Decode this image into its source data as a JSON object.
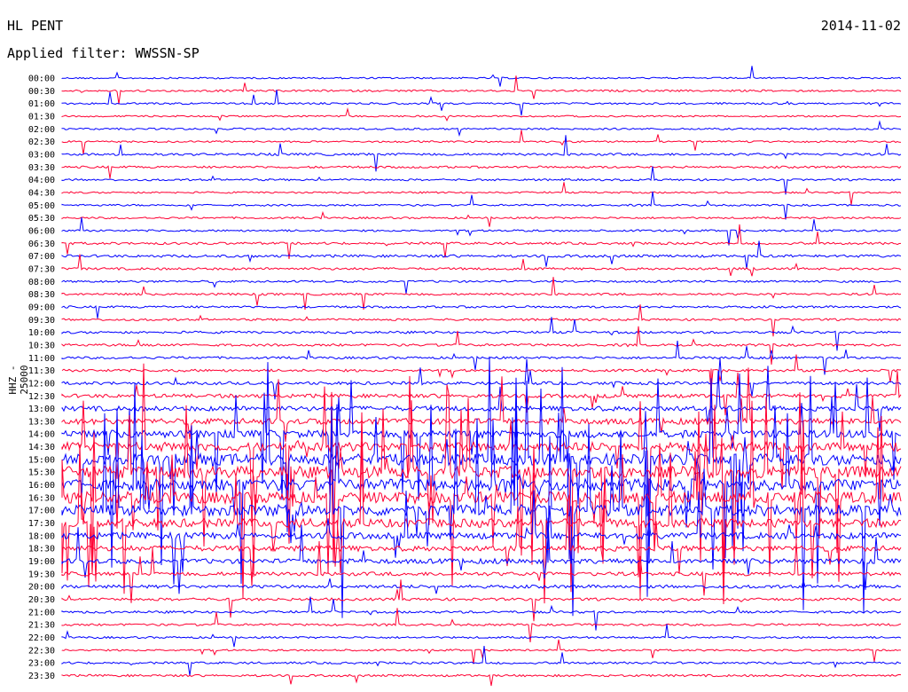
{
  "header": {
    "station": "HL PENT",
    "date": "2014-11-02",
    "filter": "Applied filter: WWSSN-SP",
    "ylabel": "HHZ - 25000"
  },
  "colors": {
    "even": "#0000ff",
    "odd": "#ff0033",
    "text": "#000000"
  },
  "chart_data": {
    "type": "line",
    "title": "HL PENT",
    "subtitle": "Applied filter: WWSSN-SP",
    "ylabel": "HHZ - 25000",
    "grid": false,
    "series_colors_alternate": [
      "blue",
      "red"
    ],
    "x": "time within 30-minute row",
    "traces": [
      {
        "label": "00:00",
        "activity": 0.05
      },
      {
        "label": "00:30",
        "activity": 0.08
      },
      {
        "label": "01:00",
        "activity": 0.08
      },
      {
        "label": "01:30",
        "activity": 0.05
      },
      {
        "label": "02:00",
        "activity": 0.07
      },
      {
        "label": "02:30",
        "activity": 0.06
      },
      {
        "label": "03:00",
        "activity": 0.12
      },
      {
        "label": "03:30",
        "activity": 0.1
      },
      {
        "label": "04:00",
        "activity": 0.08
      },
      {
        "label": "04:30",
        "activity": 0.06
      },
      {
        "label": "05:00",
        "activity": 0.07
      },
      {
        "label": "05:30",
        "activity": 0.07
      },
      {
        "label": "06:00",
        "activity": 0.08
      },
      {
        "label": "06:30",
        "activity": 0.12
      },
      {
        "label": "07:00",
        "activity": 0.14
      },
      {
        "label": "07:30",
        "activity": 0.12
      },
      {
        "label": "08:00",
        "activity": 0.09
      },
      {
        "label": "08:30",
        "activity": 0.1
      },
      {
        "label": "09:00",
        "activity": 0.1
      },
      {
        "label": "09:30",
        "activity": 0.1
      },
      {
        "label": "10:00",
        "activity": 0.12
      },
      {
        "label": "10:30",
        "activity": 0.12
      },
      {
        "label": "11:00",
        "activity": 0.12
      },
      {
        "label": "11:30",
        "activity": 0.14
      },
      {
        "label": "12:00",
        "activity": 0.18
      },
      {
        "label": "12:30",
        "activity": 0.25
      },
      {
        "label": "13:00",
        "activity": 0.35
      },
      {
        "label": "13:30",
        "activity": 0.45
      },
      {
        "label": "14:00",
        "activity": 0.6
      },
      {
        "label": "14:30",
        "activity": 0.75
      },
      {
        "label": "15:00",
        "activity": 0.95
      },
      {
        "label": "15:30",
        "activity": 1.0
      },
      {
        "label": "16:00",
        "activity": 1.0
      },
      {
        "label": "16:30",
        "activity": 1.0
      },
      {
        "label": "17:00",
        "activity": 0.95
      },
      {
        "label": "17:30",
        "activity": 0.7
      },
      {
        "label": "18:00",
        "activity": 0.5
      },
      {
        "label": "18:30",
        "activity": 0.4
      },
      {
        "label": "19:00",
        "activity": 0.35
      },
      {
        "label": "19:30",
        "activity": 0.25
      },
      {
        "label": "20:00",
        "activity": 0.2
      },
      {
        "label": "20:30",
        "activity": 0.15
      },
      {
        "label": "21:00",
        "activity": 0.12
      },
      {
        "label": "21:30",
        "activity": 0.1
      },
      {
        "label": "22:00",
        "activity": 0.08
      },
      {
        "label": "22:30",
        "activity": 0.07
      },
      {
        "label": "23:00",
        "activity": 0.1
      },
      {
        "label": "23:30",
        "activity": 0.1
      }
    ]
  }
}
